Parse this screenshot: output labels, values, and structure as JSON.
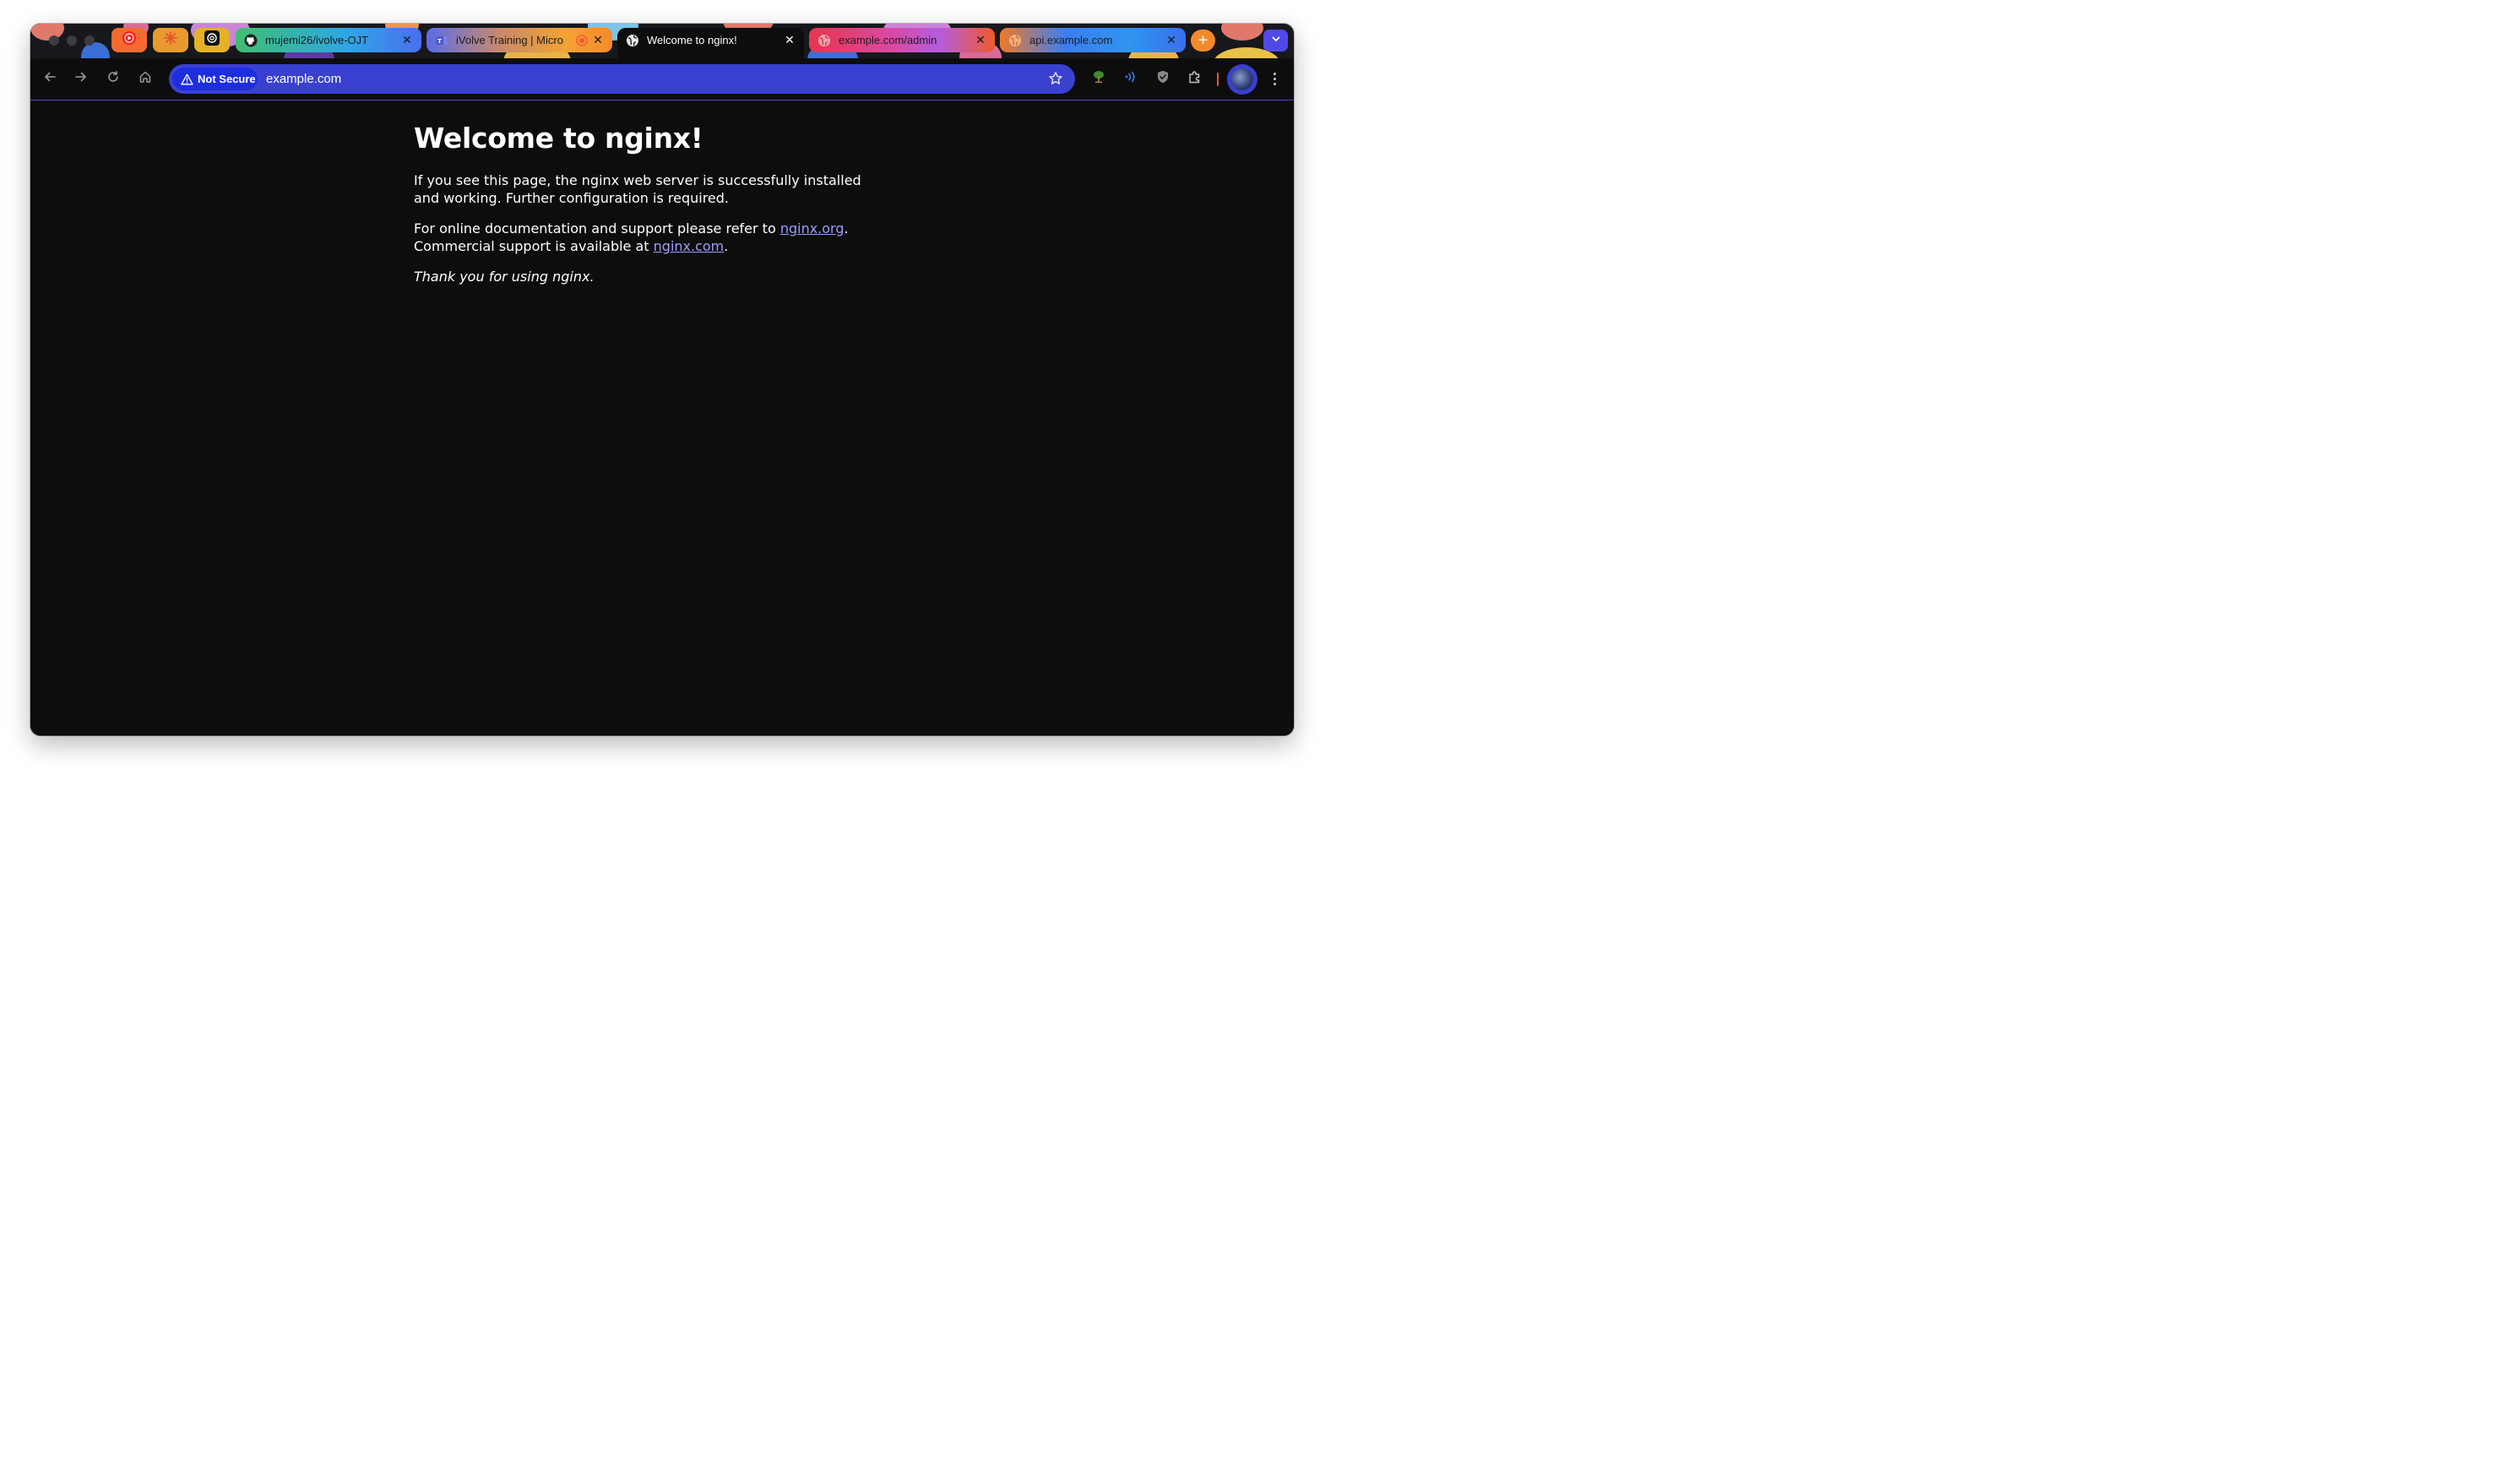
{
  "browser": {
    "tabs": [
      {
        "icon": "youtube-music-icon",
        "pinned": true
      },
      {
        "icon": "claude-icon",
        "pinned": true
      },
      {
        "icon": "openai-icon",
        "pinned": true
      },
      {
        "title": "mujemi26/ivolve-OJT",
        "icon": "github-icon"
      },
      {
        "title": "iVolve Training | Micro",
        "icon": "teams-icon",
        "badge_icon": "recording-icon"
      },
      {
        "title": "Welcome to nginx!",
        "icon": "globe-icon",
        "active": true
      },
      {
        "title": "example.com/admin",
        "icon": "globe-icon"
      },
      {
        "title": "api.example.com",
        "icon": "globe-icon"
      }
    ],
    "new_tab_label": "+",
    "address_bar": {
      "security_label": "Not Secure",
      "url": "example.com"
    }
  },
  "page": {
    "heading": "Welcome to nginx!",
    "para1": "If you see this page, the nginx web server is successfully installed and working. Further configuration is required.",
    "para2_prefix": "For online documentation and support please refer to ",
    "link1": "nginx.org",
    "para2_mid": ".",
    "para2_line2": "Commercial support is available at ",
    "link2": "nginx.com",
    "para2_end": ".",
    "thanks": "Thank you for using nginx."
  },
  "colors": {
    "accent": "#3a40d0",
    "link": "#9e9eff",
    "background": "#0d0d0d"
  }
}
